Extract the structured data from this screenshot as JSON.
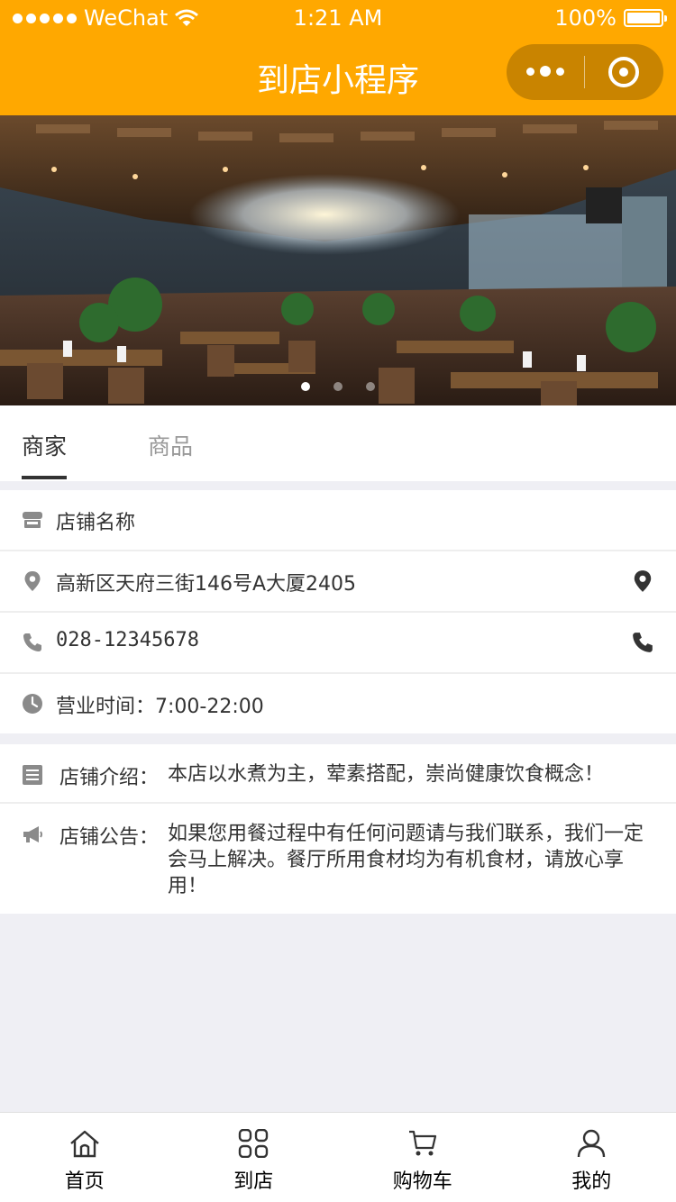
{
  "status_bar": {
    "carrier": "WeChat",
    "time": "1:21 AM",
    "battery": "100%"
  },
  "nav": {
    "title": "到店小程序"
  },
  "banner": {
    "slides": 3,
    "active_index": 0
  },
  "tabs": [
    {
      "label": "商家",
      "active": true
    },
    {
      "label": "商品",
      "active": false
    }
  ],
  "store": {
    "name": "店铺名称",
    "address": "高新区天府三街146号A大厦2405",
    "phone": "028-12345678",
    "hours": "营业时间：7:00-22:00"
  },
  "about": {
    "intro_label": "店铺介绍：",
    "intro_text": "本店以水煮为主，荤素搭配，崇尚健康饮食概念！",
    "notice_label": "店铺公告：",
    "notice_text": "如果您用餐过程中有任何问题请与我们联系，我们一定会马上解决。餐厅所用食材均为有机食材，请放心享用！"
  },
  "tabbar": [
    {
      "label": "首页",
      "icon": "home-icon"
    },
    {
      "label": "到店",
      "icon": "grid-icon"
    },
    {
      "label": "购物车",
      "icon": "cart-icon"
    },
    {
      "label": "我的",
      "icon": "user-icon"
    }
  ],
  "colors": {
    "accent": "#ffa800",
    "capsule": "#c98400",
    "background": "#efeff4",
    "icon_gray": "#8a8a8a"
  }
}
